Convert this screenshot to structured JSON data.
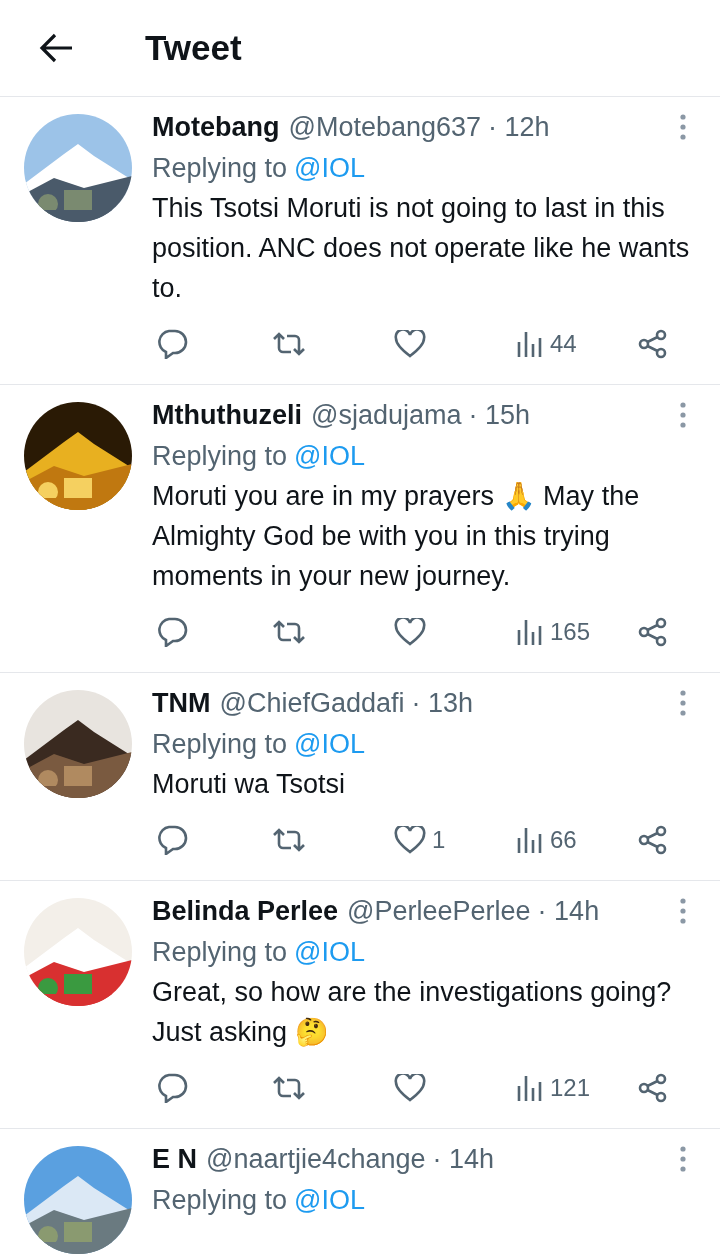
{
  "header": {
    "title": "Tweet"
  },
  "tweets": [
    {
      "name": "Motebang",
      "handle": "@Motebang637",
      "time": "· 12h",
      "replying_prefix": "Replying to",
      "replying_to": "@IOL",
      "text": "This Tsotsi Moruti is not going to last in this position. ANC does not operate like he wants to.",
      "views": "44"
    },
    {
      "name": "Mthuthuzeli",
      "handle": "@sjadujama",
      "time": "· 15h",
      "replying_prefix": "Replying to",
      "replying_to": "@IOL",
      "text": "Moruti you are in my prayers 🙏 May the Almighty God be with you in this trying moments in your new journey.",
      "views": "165"
    },
    {
      "name": "TNM",
      "handle": "@ChiefGaddafi",
      "time": "· 13h",
      "replying_prefix": "Replying to",
      "replying_to": "@IOL",
      "text": "Moruti wa Tsotsi",
      "likes": "1",
      "views": "66"
    },
    {
      "name": "Belinda Perlee",
      "handle": "@PerleePerlee",
      "time": "· 14h",
      "replying_prefix": "Replying to",
      "replying_to": "@IOL",
      "text": "Great, so how are the investigations going? Just asking 🤔",
      "views": "121"
    },
    {
      "name": "E N",
      "handle": "@naartjie4change",
      "time": "· 14h",
      "replying_prefix": "Replying to",
      "replying_to": "@IOL"
    }
  ]
}
